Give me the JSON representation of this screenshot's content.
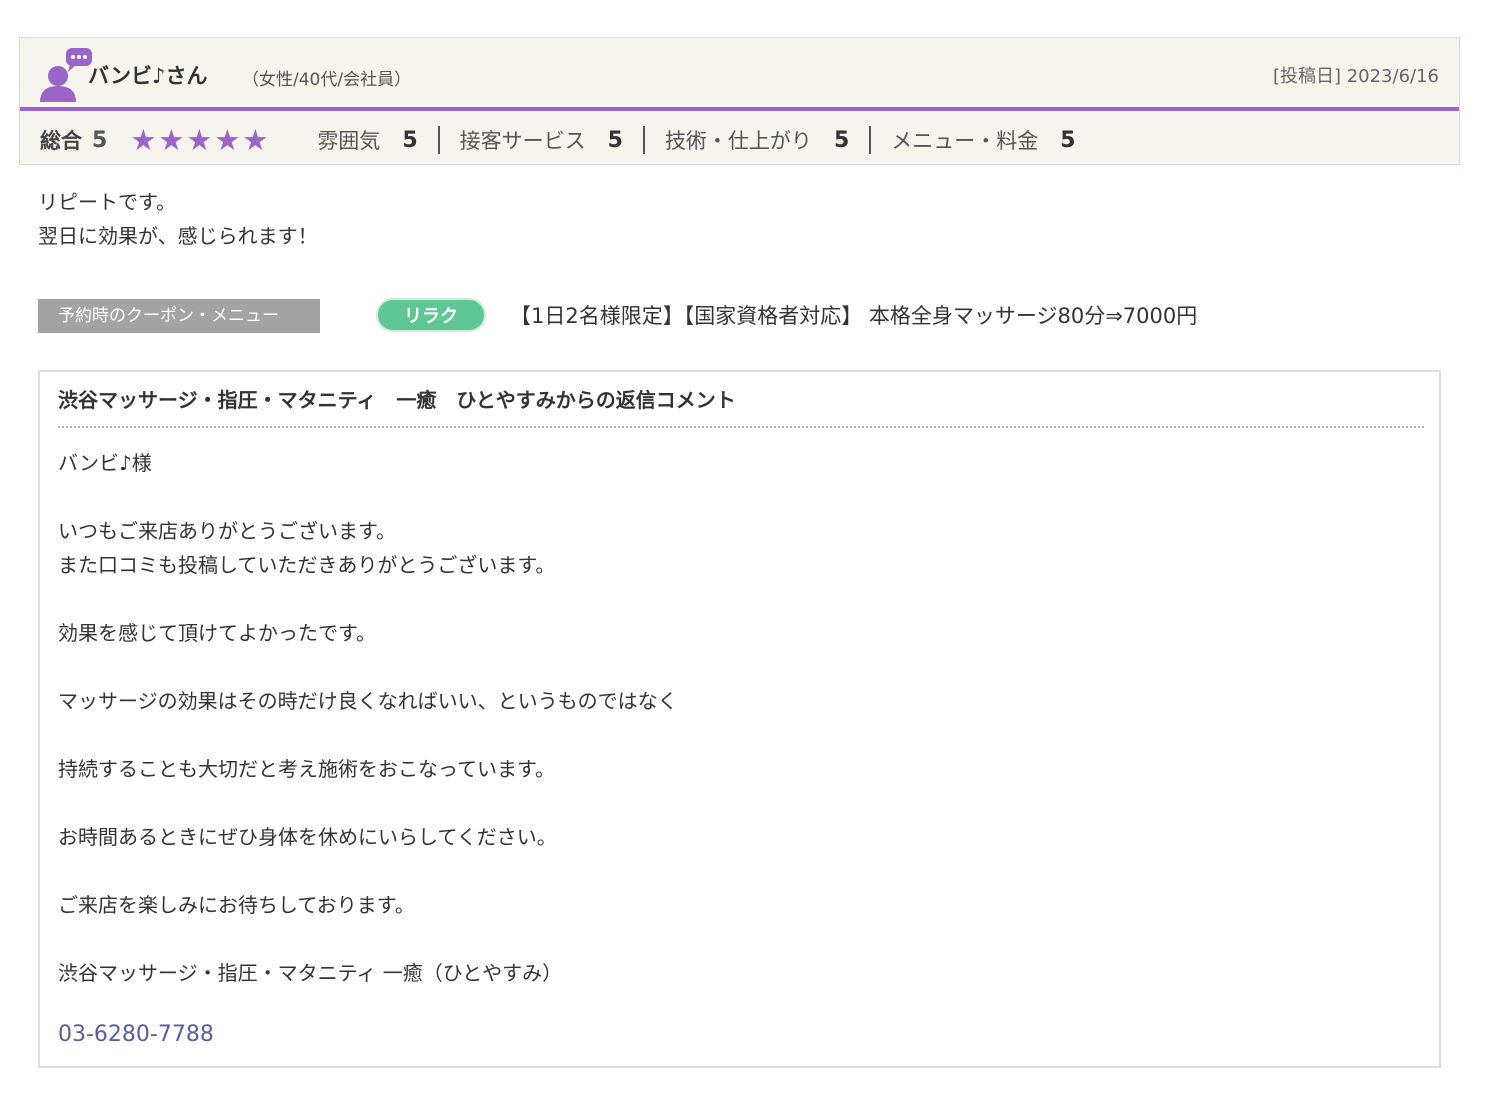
{
  "review": {
    "user_name": "バンビ♪さん",
    "user_meta": "（女性/40代/会社員）",
    "post_date": "[投稿日] 2023/6/16",
    "accent_color": "#9b64c9",
    "overall_label": "総合",
    "overall_score": "5",
    "stars": 5,
    "star_glyph": "★",
    "ratings": [
      {
        "label": "雰囲気",
        "value": "5"
      },
      {
        "label": "接客サービス",
        "value": "5"
      },
      {
        "label": "技術・仕上がり",
        "value": "5"
      },
      {
        "label": "メニュー・料金",
        "value": "5"
      }
    ],
    "body_lines": [
      "リピートです。",
      "翌日に効果が、感じられます！"
    ]
  },
  "coupon": {
    "label": "予約時のクーポン・メニュー",
    "badge": "リラク",
    "badge_color": "#5fc795",
    "text": "【1日2名様限定】【国家資格者対応】 本格全身マッサージ80分⇒7000円"
  },
  "reply": {
    "title": "渋谷マッサージ・指圧・マタニティ　一癒　ひとやすみからの返信コメント",
    "lines": [
      "バンビ♪様",
      "",
      "いつもご来店ありがとうございます。",
      "また口コミも投稿していただきありがとうございます。",
      "",
      "効果を感じて頂けてよかったです。",
      "",
      "マッサージの効果はその時だけ良くなればいい、というものではなく",
      "",
      "持続することも大切だと考え施術をおこなっています。",
      "",
      "お時間あるときにぜひ身体を休めにいらしてください。",
      "",
      "ご来店を楽しみにお待ちしております。",
      "",
      "渋谷マッサージ・指圧・マタニティ 一癒（ひとやすみ）"
    ],
    "phone": "03-6280-7788",
    "phone_color": "#5b5c9c"
  }
}
